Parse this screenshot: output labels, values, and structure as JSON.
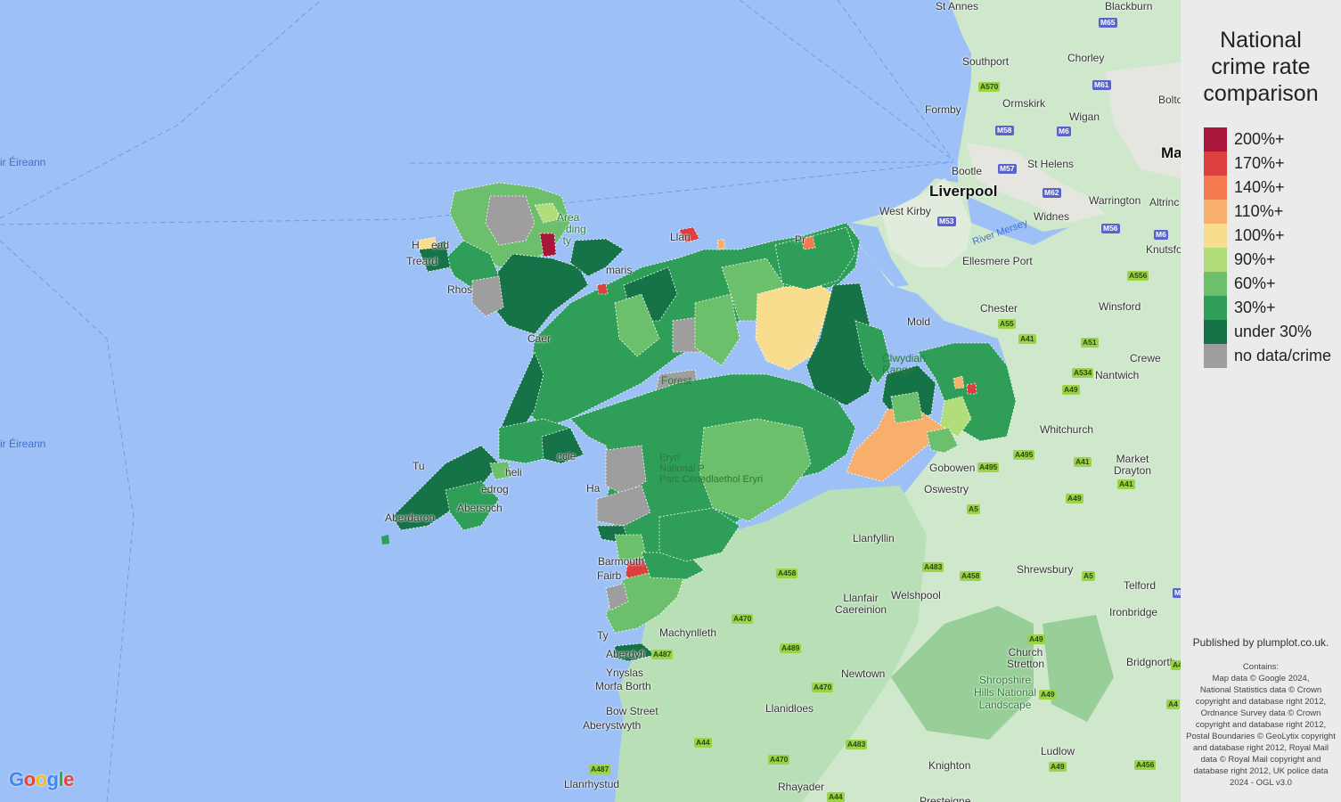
{
  "legend": {
    "title": "National\ncrime rate\ncomparison",
    "items": [
      {
        "label": "200%+",
        "color": "#a8163b"
      },
      {
        "label": "170%+",
        "color": "#db3f3f"
      },
      {
        "label": "140%+",
        "color": "#f57a4f"
      },
      {
        "label": "110%+",
        "color": "#f8af6c"
      },
      {
        "label": "100%+",
        "color": "#f9dd8f"
      },
      {
        "label": "90%+",
        "color": "#b2dd7b"
      },
      {
        "label": "60%+",
        "color": "#6cbf6b"
      },
      {
        "label": "30%+",
        "color": "#2e9e58"
      },
      {
        "label": "under 30%",
        "color": "#167347"
      },
      {
        "label": "no data/crime",
        "color": "#9e9e9e"
      }
    ]
  },
  "credits": {
    "published": "Published by plumplot.co.uk.",
    "contains": "Contains:\nMap data © Google 2024,\nNational Statistics data © Crown copyright and database right 2012, Ordnance Survey data © Crown copyright and database right 2012, Postal Boundaries © GeoLytix copyright and database right 2012, Royal Mail data © Royal Mail copyright and database right 2012, UK police data 2024 - OGL v3.0"
  },
  "map": {
    "places": [
      {
        "id": "st-annes",
        "label": "St Annes"
      },
      {
        "id": "blackburn",
        "label": "Blackburn"
      },
      {
        "id": "southport",
        "label": "Southport"
      },
      {
        "id": "chorley",
        "label": "Chorley"
      },
      {
        "id": "bolton",
        "label": "Bolton"
      },
      {
        "id": "formby",
        "label": "Formby"
      },
      {
        "id": "ormskirk",
        "label": "Ormskirk"
      },
      {
        "id": "wigan",
        "label": "Wigan"
      },
      {
        "id": "bootle",
        "label": "Bootle"
      },
      {
        "id": "st-helens",
        "label": "St Helens"
      },
      {
        "id": "liverpool",
        "label": "Liverpool"
      },
      {
        "id": "warrington",
        "label": "Warrington"
      },
      {
        "id": "altrincham",
        "label": "Altrinc"
      },
      {
        "id": "west-kirby",
        "label": "West Kirby"
      },
      {
        "id": "widnes",
        "label": "Widnes"
      },
      {
        "id": "knutsford",
        "label": "Knutsfo"
      },
      {
        "id": "ellesmere-port",
        "label": "Ellesmere Port"
      },
      {
        "id": "chester",
        "label": "Chester"
      },
      {
        "id": "winsford",
        "label": "Winsford"
      },
      {
        "id": "mold",
        "label": "Mold"
      },
      {
        "id": "crewe",
        "label": "Crewe"
      },
      {
        "id": "nantwich",
        "label": "Nantwich"
      },
      {
        "id": "whitchurch",
        "label": "Whitchurch"
      },
      {
        "id": "market-drayton",
        "label": "Market\nDrayton"
      },
      {
        "id": "gobowen",
        "label": "Gobowen"
      },
      {
        "id": "oswestry",
        "label": "Oswestry"
      },
      {
        "id": "llanfyllin",
        "label": "Llanfyllin"
      },
      {
        "id": "shrewsbury",
        "label": "Shrewsbury"
      },
      {
        "id": "welshpool",
        "label": "Welshpool"
      },
      {
        "id": "llanfair-caereinion",
        "label": "Llanfair\nCaereinion"
      },
      {
        "id": "telford",
        "label": "Telford"
      },
      {
        "id": "ironbridge",
        "label": "Ironbridge"
      },
      {
        "id": "machynlleth",
        "label": "Machynlleth"
      },
      {
        "id": "church-stretton",
        "label": "Church\nStretton"
      },
      {
        "id": "bridgnorth",
        "label": "Bridgnorth"
      },
      {
        "id": "newtown",
        "label": "Newtown"
      },
      {
        "id": "shropshire-hills",
        "label": "Shropshire\nHills National\nLandscape"
      },
      {
        "id": "ynyslas",
        "label": "Ynyslas"
      },
      {
        "id": "morfa-borth",
        "label": "Morfa Borth"
      },
      {
        "id": "bow-street",
        "label": "Bow Street"
      },
      {
        "id": "aberystwyth",
        "label": "Aberystwyth"
      },
      {
        "id": "llanidloes",
        "label": "Llanidloes"
      },
      {
        "id": "ludlow",
        "label": "Ludlow"
      },
      {
        "id": "knighton",
        "label": "Knighton"
      },
      {
        "id": "rhayader",
        "label": "Rhayader"
      },
      {
        "id": "llanrhystud",
        "label": "Llanrhystud"
      },
      {
        "id": "presteigne",
        "label": "Presteigne"
      },
      {
        "id": "barmouth",
        "label": "Barmouth"
      },
      {
        "id": "fairbourne",
        "label": "Fairb"
      },
      {
        "id": "tywyn",
        "label": "Ty"
      },
      {
        "id": "aberdyfi",
        "label": "Aberdyfi"
      },
      {
        "id": "sea-1",
        "label": "ir Éireann"
      },
      {
        "id": "sea-2",
        "label": "ir Éireann"
      },
      {
        "id": "holyhead",
        "label": "H    ead"
      },
      {
        "id": "trearddur",
        "label": "Treard"
      },
      {
        "id": "rhosneigr",
        "label": "Rhos"
      },
      {
        "id": "beaumaris",
        "label": "maris"
      },
      {
        "id": "llandudno",
        "label": "Llan"
      },
      {
        "id": "prestatyn",
        "label": "Pr"
      },
      {
        "id": "caernarfon",
        "label": "Caer"
      },
      {
        "id": "tudweiliog",
        "label": "Tu"
      },
      {
        "id": "pwllheli",
        "label": "heli"
      },
      {
        "id": "llanbedrog",
        "label": "edrog"
      },
      {
        "id": "abersoch",
        "label": "Abersoch"
      },
      {
        "id": "aberdaron",
        "label": "Aberdaron"
      },
      {
        "id": "harlech",
        "label": "Ha"
      },
      {
        "id": "criccieth",
        "label": "ccie"
      },
      {
        "id": "area-label",
        "label": "Area\n   ding\n  ty"
      },
      {
        "id": "snowdonia",
        "label": "Eryri\nNational P\nParc Cenedlaethol Eryri"
      },
      {
        "id": "forest",
        "label": "Forest"
      },
      {
        "id": "clwydian",
        "label": "Clwydian\nRange"
      },
      {
        "id": "manchester",
        "label": "Ma"
      }
    ],
    "river": "River Mersey",
    "roads": [
      "M65",
      "M61",
      "A570",
      "M58",
      "M6",
      "M57",
      "M62",
      "M53",
      "M56",
      "M6",
      "A556",
      "A55",
      "A41",
      "A51",
      "A534",
      "A49",
      "A41",
      "A49",
      "A5",
      "A495",
      "A495",
      "A41",
      "A483",
      "A458",
      "A5",
      "A458",
      "A470",
      "A489",
      "A470",
      "A483",
      "A49",
      "A487",
      "A44",
      "A470",
      "A44",
      "A49",
      "A456",
      "A4",
      "A487",
      "A49",
      "M6",
      "A4"
    ]
  }
}
